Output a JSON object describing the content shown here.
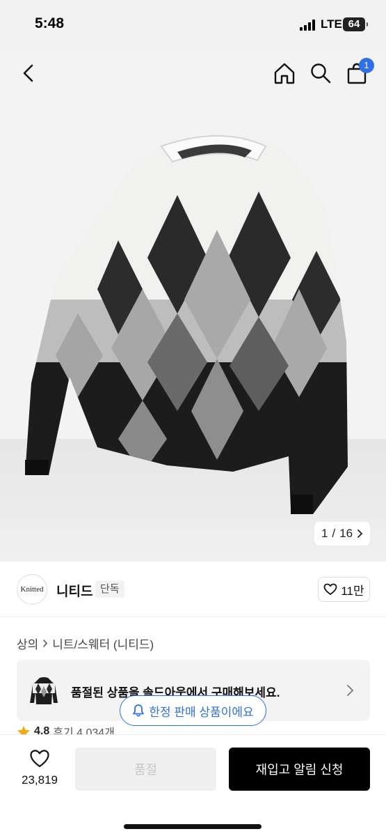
{
  "status_bar": {
    "time": "5:48",
    "network": "LTE",
    "battery": "64"
  },
  "header": {
    "cart_count": "1"
  },
  "gallery": {
    "current": "1",
    "separator": "/",
    "total": "16"
  },
  "brand": {
    "logo_text": "Knitted",
    "name": "니티드",
    "tag": "단독",
    "likes": "11만"
  },
  "breadcrumb": {
    "category": "상의",
    "subcategory": "니트/스웨터 (니티드)"
  },
  "soldout_banner": {
    "text": "품절된 상품을 솔드아웃에서 구매해보세요."
  },
  "limited_notice": {
    "text": "한정 판매 상품이에요"
  },
  "rating": {
    "score": "4.8",
    "reviews": "후기 4,034개"
  },
  "bottom_bar": {
    "wish_count": "23,819",
    "soldout_label": "품절",
    "restock_label": "재입고 알림 신청"
  },
  "colors": {
    "accent": "#2f6fe8",
    "primary_button": "#000000",
    "disabled_button": "#efefef"
  },
  "icons": [
    "back-icon",
    "home-icon",
    "search-icon",
    "cart-icon",
    "heart-icon",
    "bell-icon",
    "chevron-right-icon",
    "star-icon"
  ]
}
